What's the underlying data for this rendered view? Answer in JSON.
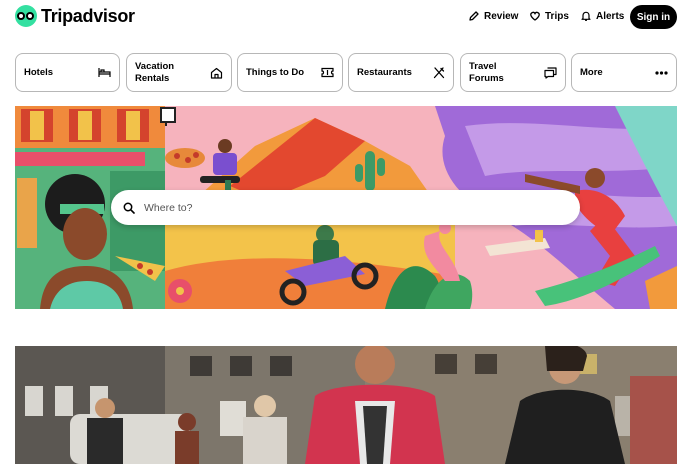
{
  "brand": {
    "name": "Tripadvisor"
  },
  "header": {
    "review_label": "Review",
    "trips_label": "Trips",
    "alerts_label": "Alerts",
    "signin_label": "Sign in"
  },
  "categories": [
    {
      "label": "Hotels",
      "icon": "bed-icon"
    },
    {
      "label": "Vacation Rentals",
      "icon": "house-icon"
    },
    {
      "label": "Things to Do",
      "icon": "ticket-icon"
    },
    {
      "label": "Restaurants",
      "icon": "fork-knife-icon"
    },
    {
      "label": "Travel Forums",
      "icon": "chat-icon"
    },
    {
      "label": "More",
      "icon": "more-dots-icon"
    }
  ],
  "search": {
    "placeholder": "Where to?"
  },
  "colors": {
    "brand_green": "#34e0a1",
    "text": "#000000",
    "border": "#b7b7b7"
  }
}
